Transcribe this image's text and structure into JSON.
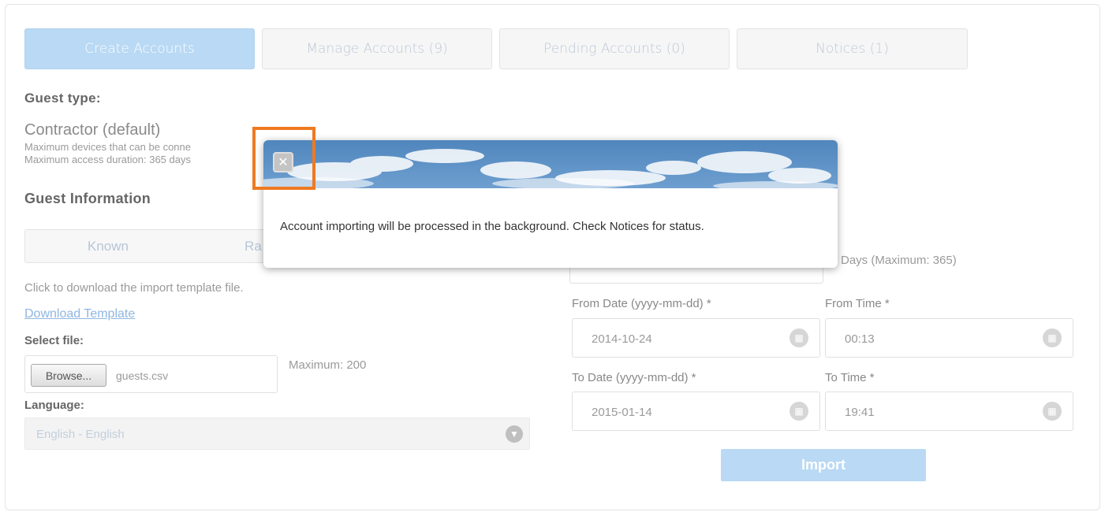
{
  "tabs": [
    {
      "label": "Create Accounts",
      "active": true
    },
    {
      "label": "Manage Accounts (9)",
      "active": false
    },
    {
      "label": "Pending Accounts (0)",
      "active": false
    },
    {
      "label": "Notices (1)",
      "active": false
    }
  ],
  "guest_type": {
    "title": "Guest type:",
    "name": "Contractor (default)",
    "line1": "Maximum devices that can be conne",
    "line2": "Maximum access duration: 365 days"
  },
  "guest_info": {
    "title": "Guest Information",
    "mode_known": "Known",
    "mode_random": "Ra",
    "download_hint": "Click to download the import template file.",
    "download_link": "Download Template",
    "select_file_label": "Select file:",
    "browse_label": "Browse...",
    "file_name": "guests.csv",
    "max_label": "Maximum: 200",
    "language_label": "Language:",
    "language_value": "English - English"
  },
  "duration": {
    "days_hint": "Days (Maximum: 365)",
    "from_date_label": "From Date (yyyy-mm-dd) *",
    "from_date": "2014-10-24",
    "from_time_label": "From Time *",
    "from_time": "00:13",
    "to_date_label": "To Date (yyyy-mm-dd) *",
    "to_date": "2015-01-14",
    "to_time_label": "To Time *",
    "to_time": "19:41"
  },
  "import_label": "Import",
  "modal": {
    "message": "Account importing will be processed in the background. Check Notices for status.",
    "close_icon": "close-icon"
  },
  "colors": {
    "accent": "#b9d9f4",
    "highlight": "#ee7a22"
  }
}
